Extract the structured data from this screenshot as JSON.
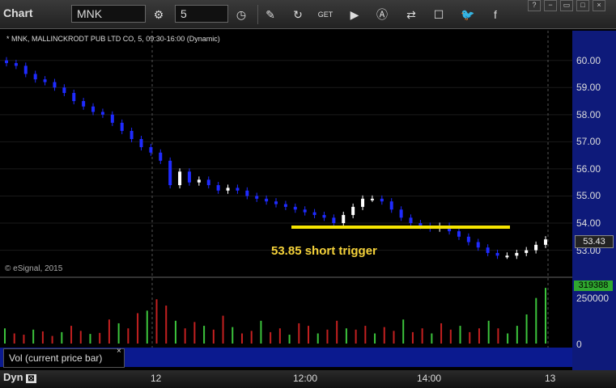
{
  "toolbar": {
    "title": "Chart",
    "symbol": "MNK",
    "interval": "5",
    "icons": [
      "settings-icon",
      "history-icon",
      "draw-icon",
      "refresh-icon",
      "get-icon",
      "play-icon",
      "alert-icon",
      "link-icon",
      "chat-icon",
      "twitter-icon",
      "facebook-icon"
    ]
  },
  "chart": {
    "header": "* MNK, MALLINCKRODT PUB LTD CO, 5, 09:30-16:00 (Dynamic)",
    "copyright": "© eSignal, 2015",
    "annotation": "53.85 short trigger",
    "last_price": "53.43",
    "price_axis": [
      "60.00",
      "59.00",
      "58.00",
      "57.00",
      "56.00",
      "55.00",
      "54.00",
      "53.00"
    ],
    "trigger_level": 53.85
  },
  "volume": {
    "label": "Vol (current price bar)",
    "close": "×",
    "value": "319388",
    "axis": [
      "250000",
      "0"
    ]
  },
  "time_axis": [
    "12",
    "12:00",
    "14:00",
    "13"
  ],
  "bottom": {
    "dyn": "Dyn"
  },
  "colors": {
    "up_candle": "#ffffff",
    "down_candle": "#1f2bff",
    "trigger_line": "#f5e400",
    "vol_up": "#3cc43c",
    "vol_down": "#c42020",
    "axis_panel": "#0e1a7a"
  },
  "chart_data": {
    "type": "candlestick",
    "price_range": [
      52.6,
      60.2
    ],
    "close_series": [
      59.9,
      59.8,
      59.5,
      59.3,
      59.2,
      59.0,
      58.8,
      58.5,
      58.3,
      58.1,
      58.0,
      57.7,
      57.4,
      57.1,
      56.8,
      56.6,
      56.3,
      55.4,
      55.9,
      55.5,
      55.6,
      55.4,
      55.2,
      55.3,
      55.2,
      55.0,
      54.9,
      54.8,
      54.7,
      54.6,
      54.5,
      54.4,
      54.3,
      54.2,
      54.0,
      54.3,
      54.6,
      54.9,
      54.9,
      54.8,
      54.5,
      54.2,
      54.0,
      53.9,
      53.8,
      53.9,
      53.7,
      53.5,
      53.3,
      53.1,
      52.9,
      52.8,
      52.8,
      52.9,
      53.0,
      53.2,
      53.4
    ],
    "volume_series": [
      60,
      40,
      35,
      55,
      48,
      30,
      45,
      70,
      50,
      38,
      42,
      95,
      80,
      60,
      120,
      130,
      175,
      150,
      90,
      60,
      85,
      70,
      55,
      110,
      65,
      40,
      50,
      90,
      45,
      60,
      35,
      80,
      70,
      40,
      55,
      90,
      60,
      55,
      70,
      40,
      65,
      50,
      95,
      45,
      60,
      40,
      80,
      55,
      70,
      45,
      60,
      90,
      60,
      40,
      70,
      115,
      180,
      220
    ]
  }
}
